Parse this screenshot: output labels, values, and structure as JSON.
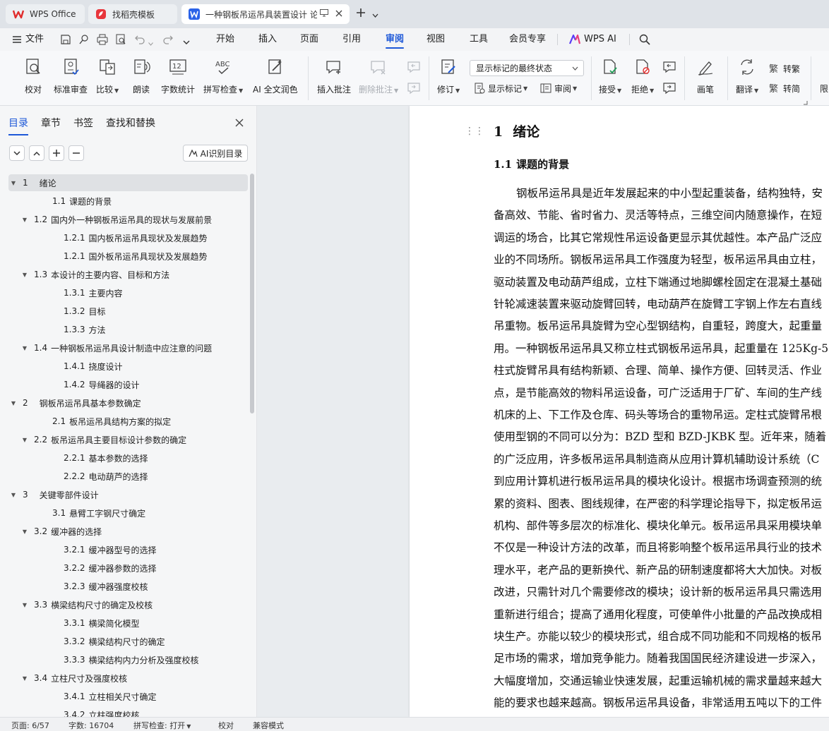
{
  "tabs": [
    {
      "label": "WPS Office",
      "icon": "wps-logo-icon"
    },
    {
      "label": "找稻壳模板",
      "icon": "docer-logo-icon"
    },
    {
      "label": "一种钢板吊运吊具装置设计 论",
      "icon": "word-doc-icon"
    }
  ],
  "menu": {
    "file": "文件",
    "items": [
      "开始",
      "插入",
      "页面",
      "引用",
      "审阅",
      "视图",
      "工具",
      "会员专享"
    ],
    "active": "审阅",
    "wps_ai": "WPS AI"
  },
  "ribbon": {
    "proofread": "校对",
    "standard_review": "标准审查",
    "compare": "比较",
    "read_aloud": "朗读",
    "word_count": "字数统计",
    "spell_check": "拼写检查",
    "ai_polish": "AI 全文润色",
    "insert_comment": "插入批注",
    "delete_comment": "删除批注",
    "track_changes": "修订",
    "markup_select": "显示标记的最终状态",
    "show_markup": "显示标记",
    "review_pane": "审阅",
    "accept": "接受",
    "reject": "拒绝",
    "ink": "画笔",
    "translate": "翻译",
    "to_traditional": "转繁",
    "to_simplified": "转简",
    "restrict": "限"
  },
  "panel": {
    "tabs": [
      "目录",
      "章节",
      "书签",
      "查找和替换"
    ],
    "ai_toc": "AI识别目录",
    "toc": [
      {
        "num": "1",
        "title": "绪论",
        "level": 1,
        "expanded": true
      },
      {
        "num": "1.1",
        "title": "课题的背景",
        "level": 2
      },
      {
        "num": "1.2",
        "title": "国内外一种钢板吊运吊具的现状与发展前景",
        "level": 2,
        "expanded": true
      },
      {
        "num": "1.2.1",
        "title": "国内板吊运吊具现状及发展趋势",
        "level": 3
      },
      {
        "num": "1.2.1",
        "title": "国外板吊运吊具现状及发展趋势",
        "level": 3
      },
      {
        "num": "1.3",
        "title": "本设计的主要内容、目标和方法",
        "level": 2,
        "expanded": true
      },
      {
        "num": "1.3.1",
        "title": "主要内容",
        "level": 3
      },
      {
        "num": "1.3.2",
        "title": "目标",
        "level": 3
      },
      {
        "num": "1.3.3",
        "title": "方法",
        "level": 3
      },
      {
        "num": "1.4",
        "title": "一种钢板吊运吊具设计制造中应注意的问题",
        "level": 2,
        "expanded": true
      },
      {
        "num": "1.4.1",
        "title": "挠度设计",
        "level": 3
      },
      {
        "num": "1.4.2",
        "title": "导绳器的设计",
        "level": 3
      },
      {
        "num": "2",
        "title": "钢板吊运吊具基本参数确定",
        "level": 1,
        "expanded": true
      },
      {
        "num": "2.1",
        "title": "板吊运吊具结构方案的拟定",
        "level": 2
      },
      {
        "num": "2.2",
        "title": "板吊运吊具主要目标设计参数的确定",
        "level": 2,
        "expanded": true
      },
      {
        "num": "2.2.1",
        "title": "基本参数的选择",
        "level": 3
      },
      {
        "num": "2.2.2",
        "title": "电动葫芦的选择",
        "level": 3
      },
      {
        "num": "3",
        "title": "关键零部件设计",
        "level": 1,
        "expanded": true
      },
      {
        "num": "3.1",
        "title": "悬臂工字钢尺寸确定",
        "level": 2
      },
      {
        "num": "3.2",
        "title": "缓冲器的选择",
        "level": 2,
        "expanded": true
      },
      {
        "num": "3.2.1",
        "title": "缓冲器型号的选择",
        "level": 3
      },
      {
        "num": "3.2.2",
        "title": "缓冲器参数的选择",
        "level": 3
      },
      {
        "num": "3.2.3",
        "title": "缓冲器强度校核",
        "level": 3
      },
      {
        "num": "3.3",
        "title": "横梁结构尺寸的确定及校核",
        "level": 2,
        "expanded": true
      },
      {
        "num": "3.3.1",
        "title": "横梁简化模型",
        "level": 3
      },
      {
        "num": "3.3.2",
        "title": "横梁结构尺寸的确定",
        "level": 3
      },
      {
        "num": "3.3.3",
        "title": "横梁结构内力分析及强度校核",
        "level": 3
      },
      {
        "num": "3.4",
        "title": "立柱尺寸及强度校核",
        "level": 2,
        "expanded": true
      },
      {
        "num": "3.4.1",
        "title": "立柱相关尺寸确定",
        "level": 3
      },
      {
        "num": "3.4.2",
        "title": "立柱强度校核",
        "level": 3
      }
    ]
  },
  "document": {
    "heading1": {
      "num": "1",
      "title": "绪论"
    },
    "heading2": {
      "num": "1.1",
      "title": "课题的背景"
    },
    "lines": [
      "钢板吊运吊具是近年发展起来的中小型起重装备，结构独特，安",
      "备高效、节能、省时省力、灵活等特点，三维空间内随意操作，在短",
      "调运的场合，比其它常规性吊运设备更显示其优越性。本产品广泛应",
      "业的不同场所。钢板吊运吊具工作强度为轻型，板吊运吊具由立柱，",
      "驱动装置及电动葫芦组成，立柱下端通过地脚螺栓固定在混凝土基础",
      "针轮减速装置来驱动旋臂回转，电动葫芦在旋臂工字钢上作左右直线",
      "吊重物。板吊运吊具旋臂为空心型钢结构，自重轻，跨度大，起重量",
      "用。一种钢板吊运吊具又称立柱式钢板吊运吊具，起重量在 125Kg-5",
      "柱式旋臂吊具有结构新颖、合理、简单、操作方便、回转灵活、作业",
      "点，是节能高效的物料吊运设备，可广泛适用于厂矿、车间的生产线",
      "机床的上、下工作及仓库、码头等场合的重物吊运。定柱式旋臂吊根",
      "使用型钢的不同可以分为：BZD 型和 BZD-JKBK 型。近年来，随着",
      "的广泛应用，许多板吊运吊具制造商从应用计算机辅助设计系统（C",
      "到应用计算机进行板吊运吊具的模块化设计。根据市场调查预测的统",
      "累的资料、图表、图线规律，在严密的科学理论指导下，拟定板吊运",
      "机构、部件等多层次的标准化、模块化单元。板吊运吊具采用模块单",
      "不仅是一种设计方法的改革，而且将影响整个板吊运吊具行业的技术",
      "理水平，老产品的更新换代、新产品的研制速度都将大大加快。对板",
      "改进，只需针对几个需要修改的模块；设计新的板吊运吊具只需选用",
      "重新进行组合；提高了通用化程度，可使单件小批量的产品改换成相",
      "块生产。亦能以较少的模块形式，组合成不同功能和不同规格的板吊",
      "足市场的需求，增加竞争能力。随着我国国民经济建设进一步深入，",
      "大幅度增加，交通运输业快速发展，起重运输机械的需求量越来越大",
      "能的要求也越来越高。钢板吊运吊具设备，非常适用五吨以下的工件"
    ]
  },
  "status": {
    "page": "页面: 6/57",
    "words": "字数: 16704",
    "spell": "拼写检查: 打开",
    "proof": "校对",
    "compat": "兼容模式"
  }
}
